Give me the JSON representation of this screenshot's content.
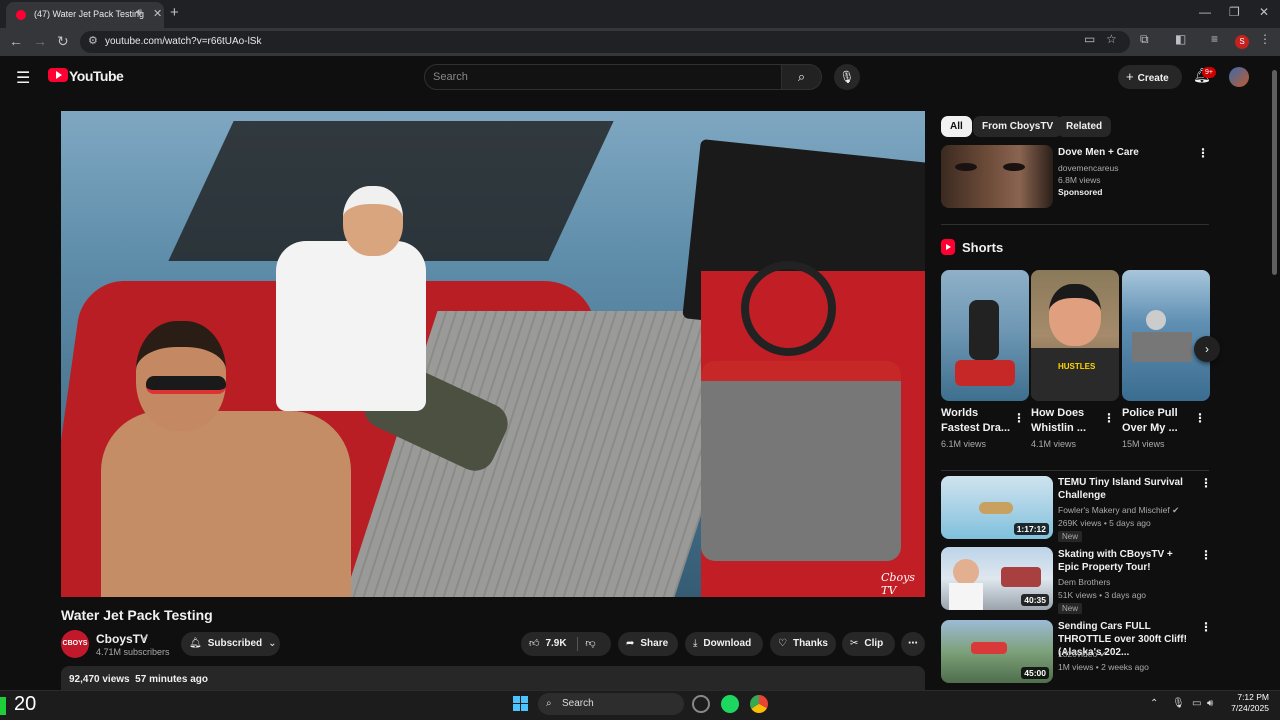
{
  "browser": {
    "tab_title": "(47) Water Jet Pack Testing",
    "url": "youtube.com/watch?v=r66tUAo-lSk",
    "profile_initial": "S"
  },
  "header": {
    "logo_text": "YouTube",
    "search_placeholder": "Search",
    "create_label": "Create",
    "notification_count": "9+"
  },
  "video": {
    "title": "Water Jet Pack Testing",
    "watermark": "Cboys TV",
    "channel_name": "CboysTV",
    "channel_avatar_text": "CBOYS",
    "subscribers": "4.71M subscribers",
    "subscribed_label": "Subscribed",
    "likes": "7.9K",
    "share_label": "Share",
    "download_label": "Download",
    "thanks_label": "Thanks",
    "clip_label": "Clip",
    "views": "92,470 views",
    "posted": "57 minutes ago"
  },
  "sidebar": {
    "chips": [
      "All",
      "From CboysTV",
      "Related"
    ],
    "ad": {
      "title": "Dove Men + Care",
      "channel": "dovemencareus",
      "views": "6.8M views",
      "label": "Sponsored"
    },
    "shorts_heading": "Shorts",
    "shorts": [
      {
        "title": "Worlds Fastest Dra...",
        "views": "6.1M views"
      },
      {
        "title": "How Does Whistlin ...",
        "views": "4.1M views",
        "overlay": "HUSTLES"
      },
      {
        "title": "Police Pull Over My ...",
        "views": "15M views"
      }
    ],
    "related": [
      {
        "title": "TEMU Tiny Island Survival Challenge",
        "channel": "Fowler's Makery and Mischief",
        "meta": "269K views • 5 days ago",
        "duration": "1:17:12",
        "badge": "New"
      },
      {
        "title": "Skating with CBoysTV + Epic Property Tour!",
        "channel": "Dem Brothers",
        "meta": "51K views • 3 days ago",
        "duration": "40:35",
        "badge": "New"
      },
      {
        "title": "Sending Cars FULL THROTTLE over 300ft Cliff! (Alaska's 202...",
        "channel": "1320video",
        "meta": "1M views • 2 weeks ago",
        "duration": "45:00"
      }
    ]
  },
  "taskbar": {
    "temperature": "20",
    "search_label": "Search",
    "time": "7:12 PM",
    "date": "7/24/2025"
  }
}
